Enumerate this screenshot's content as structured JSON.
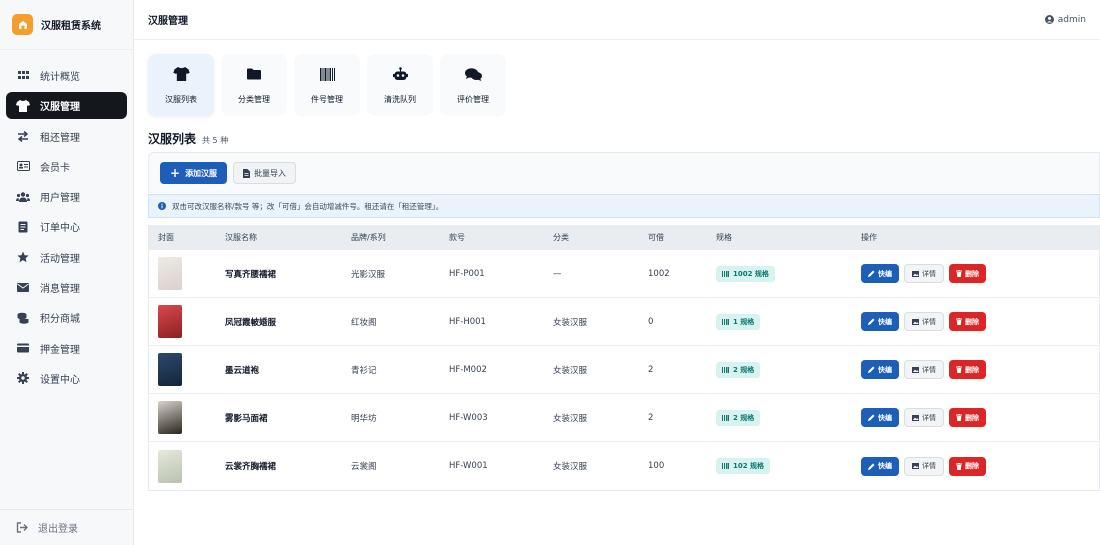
{
  "app": {
    "title": "汉服租赁系统"
  },
  "sidebar": {
    "items": [
      {
        "label": "统计概览",
        "icon": "grid-icon"
      },
      {
        "label": "汉服管理",
        "icon": "shirt-icon",
        "active": true
      },
      {
        "label": "租还管理",
        "icon": "exchange-icon"
      },
      {
        "label": "会员卡",
        "icon": "id-card-icon"
      },
      {
        "label": "用户管理",
        "icon": "users-icon"
      },
      {
        "label": "订单中心",
        "icon": "document-icon"
      },
      {
        "label": "活动管理",
        "icon": "star-icon"
      },
      {
        "label": "消息管理",
        "icon": "envelope-icon"
      },
      {
        "label": "积分商城",
        "icon": "coins-icon"
      },
      {
        "label": "押金管理",
        "icon": "wallet-icon"
      },
      {
        "label": "设置中心",
        "icon": "gear-icon"
      }
    ],
    "logout_label": "退出登录"
  },
  "header": {
    "title": "汉服管理",
    "user": "admin"
  },
  "tabs": [
    {
      "label": "汉服列表",
      "icon": "shirt-icon",
      "active": true
    },
    {
      "label": "分类管理",
      "icon": "folder-icon"
    },
    {
      "label": "件号管理",
      "icon": "barcode-icon"
    },
    {
      "label": "清洗队列",
      "icon": "robot-icon"
    },
    {
      "label": "评价管理",
      "icon": "comments-icon"
    }
  ],
  "section": {
    "title": "汉服列表",
    "count": "共 5 种"
  },
  "toolbar": {
    "add_label": "添加汉服",
    "import_label": "批量导入"
  },
  "info": {
    "text": "双击可改汉服名称/款号 等；改「可借」会自动增减件号。租还请在「租还管理」。"
  },
  "table": {
    "headers": [
      "封面",
      "汉服名称",
      "品牌/系列",
      "款号",
      "分类",
      "可借",
      "规格",
      "操作"
    ],
    "rows": [
      {
        "name": "写真齐腰襦裙",
        "brand": "光影汉服",
        "code": "HF-P001",
        "category": "—",
        "available": "1002",
        "spec": "1002 规格",
        "thumb": [
          "#efeae6",
          "#d9d0cc"
        ]
      },
      {
        "name": "凤冠霞帔婚服",
        "brand": "红妆阁",
        "code": "HF-H001",
        "category": "女装汉服",
        "available": "0",
        "spec": "1 规格",
        "thumb": [
          "#d9494a",
          "#8d1f24"
        ]
      },
      {
        "name": "墨云道袍",
        "brand": "青衫记",
        "code": "HF-M002",
        "category": "女装汉服",
        "available": "2",
        "spec": "2 规格",
        "thumb": [
          "#2b4a6e",
          "#13253a"
        ]
      },
      {
        "name": "雾影马面裙",
        "brand": "明华坊",
        "code": "HF-W003",
        "category": "女装汉服",
        "available": "2",
        "spec": "2 规格",
        "thumb": [
          "#d8d2c8",
          "#2a2420"
        ]
      },
      {
        "name": "云裳齐胸襦裙",
        "brand": "云裳阁",
        "code": "HF-W001",
        "category": "女装汉服",
        "available": "100",
        "spec": "102 规格",
        "thumb": [
          "#e6e8dc",
          "#b9c2ae"
        ]
      }
    ],
    "actions": {
      "edit": "快编",
      "detail": "详情",
      "delete": "删除"
    }
  },
  "colors": {
    "primary": "#1d5fb8",
    "danger": "#dc2626",
    "badge_bg": "#d6f3ef",
    "badge_text": "#0f766e",
    "active_nav": "#14171c",
    "brand": "#f59e2c"
  }
}
